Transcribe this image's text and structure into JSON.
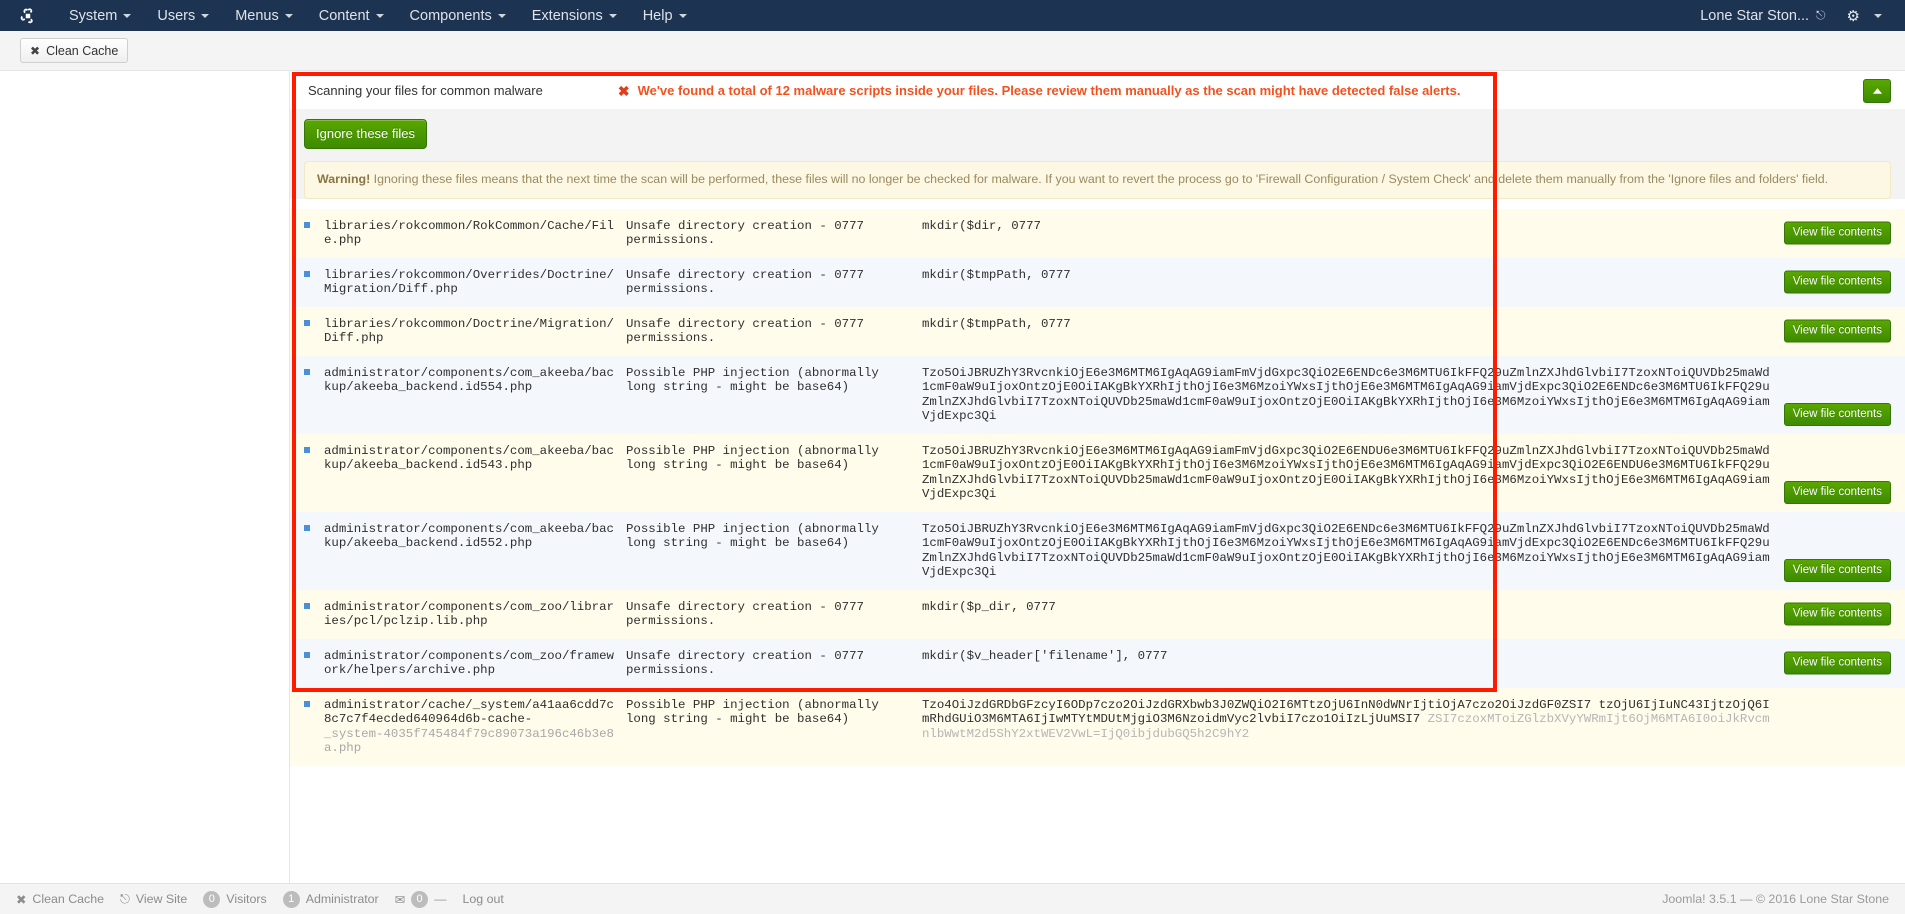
{
  "adminbar": {
    "logo_icon": "joomla-logo-icon",
    "menus": [
      {
        "label": "System"
      },
      {
        "label": "Users"
      },
      {
        "label": "Menus"
      },
      {
        "label": "Content"
      },
      {
        "label": "Components"
      },
      {
        "label": "Extensions"
      },
      {
        "label": "Help"
      }
    ],
    "site_name": "Lone Star Ston...",
    "external_link_icon": "external-link-icon",
    "gear_icon": "gear-icon"
  },
  "toolbar": {
    "clean_cache_label": "Clean Cache",
    "clean_cache_icon": "wrench-icon"
  },
  "panel": {
    "title": "Scanning your files for common malware",
    "alert_icon": "error-x-icon",
    "alert_text": "We've found a total of 12 malware scripts inside your files. Please review them manually as the scan might have detected false alerts.",
    "ignore_button": "Ignore these files",
    "warning_label": "Warning!",
    "warning_text": " Ignoring these files means that the next time the scan will be performed, these files will no longer be checked for malware. If you want to revert the process go to 'Firewall Configuration / System Check' and delete them manually from the 'Ignore files and folders' field.",
    "view_button_label": "View file contents",
    "scroll_top_icon": "chevron-up-icon"
  },
  "colors": {
    "accent_green": "#4a9600",
    "alert_red": "#f4511e",
    "highlight_box": "#ff1a00",
    "adminbar_bg": "#1c3352",
    "row_odd": "#fffceb",
    "row_even": "#f4f8fd"
  },
  "rows": [
    {
      "path": "libraries/rokcommon/RokCommon/Cache/File.php",
      "reason": "Unsafe directory creation - 0777 permissions.",
      "code": "mkdir($dir, 0777",
      "btn_pos": "middle"
    },
    {
      "path": "libraries/rokcommon/Overrides/Doctrine/Migration/Diff.php",
      "reason": "Unsafe directory creation - 0777 permissions.",
      "code": "mkdir($tmpPath, 0777",
      "btn_pos": "middle"
    },
    {
      "path": "libraries/rokcommon/Doctrine/Migration/Diff.php",
      "reason": "Unsafe directory creation - 0777 permissions.",
      "code": "mkdir($tmpPath, 0777",
      "btn_pos": "middle"
    },
    {
      "path": "administrator/components/com_akeeba/backup/akeeba_backend.id554.php",
      "reason": "Possible PHP injection (abnormally long string - might be base64)",
      "code": "Tzo5OiJBRUZhY3RvcnkiOjE6e3M6MTM6IgAqAG9iamFmVjdGxpc3QiO2E6ENDc6e3M6MTU6IkFFQ29uZmlnZXJhdGlvbiI7TzoxNToiQUVDb25maWd1cmF0aW9uIjoxOntzOjE0OiIAKgBkYXRhIjthOjI6e3M6MzoiYWxsIjthOjE6e3M6MTM6IgAqAG9iamVjdExpc3QiO2E6ENDc6e3M6MTU6IkFFQ29uZmlnZXJhdGlvbiI7TzoxNToiQUVDb25maWd1cmF0aW9uIjoxOntzOjE0OiIAKgBkYXRhIjthOjI6e3M6MzoiYWxsIjthOjE6e3M6MTM6IgAqAG9iamVjdExpc3Qi",
      "btn_pos": "bottom"
    },
    {
      "path": "administrator/components/com_akeeba/backup/akeeba_backend.id543.php",
      "reason": "Possible PHP injection (abnormally long string - might be base64)",
      "code": "Tzo5OiJBRUZhY3RvcnkiOjE6e3M6MTM6IgAqAG9iamFmVjdGxpc3QiO2E6ENDU6e3M6MTU6IkFFQ29uZmlnZXJhdGlvbiI7TzoxNToiQUVDb25maWd1cmF0aW9uIjoxOntzOjE0OiIAKgBkYXRhIjthOjI6e3M6MzoiYWxsIjthOjE6e3M6MTM6IgAqAG9iamVjdExpc3QiO2E6ENDU6e3M6MTU6IkFFQ29uZmlnZXJhdGlvbiI7TzoxNToiQUVDb25maWd1cmF0aW9uIjoxOntzOjE0OiIAKgBkYXRhIjthOjI6e3M6MzoiYWxsIjthOjE6e3M6MTM6IgAqAG9iamVjdExpc3Qi",
      "btn_pos": "bottom"
    },
    {
      "path": "administrator/components/com_akeeba/backup/akeeba_backend.id552.php",
      "reason": "Possible PHP injection (abnormally long string - might be base64)",
      "code": "Tzo5OiJBRUZhY3RvcnkiOjE6e3M6MTM6IgAqAG9iamFmVjdGxpc3QiO2E6ENDc6e3M6MTU6IkFFQ29uZmlnZXJhdGlvbiI7TzoxNToiQUVDb25maWd1cmF0aW9uIjoxOntzOjE0OiIAKgBkYXRhIjthOjI6e3M6MzoiYWxsIjthOjE6e3M6MTM6IgAqAG9iamVjdExpc3QiO2E6ENDc6e3M6MTU6IkFFQ29uZmlnZXJhdGlvbiI7TzoxNToiQUVDb25maWd1cmF0aW9uIjoxOntzOjE0OiIAKgBkYXRhIjthOjI6e3M6MzoiYWxsIjthOjE6e3M6MTM6IgAqAG9iamVjdExpc3Qi",
      "btn_pos": "bottom"
    },
    {
      "path": "administrator/components/com_zoo/libraries/pcl/pclzip.lib.php",
      "reason": "Unsafe directory creation - 0777 permissions.",
      "code": "mkdir($p_dir, 0777",
      "btn_pos": "middle"
    },
    {
      "path": "administrator/components/com_zoo/framework/helpers/archive.php",
      "reason": "Unsafe directory creation - 0777 permissions.",
      "code": "mkdir($v_header['filename'], 0777",
      "btn_pos": "middle"
    },
    {
      "path": "administrator/cache/_system/a41aa6cdd7c8c7c7f4ecded640964d6b-cache-",
      "path_muted": "_system-4035f745484f79c89073a196c46b3e8a.php",
      "reason": "Possible PHP injection (abnormally long string - might be base64)",
      "code": "Tzo4OiJzdGRDbGFzcyI6ODp7czo2OiJzdGRXbwb3J0ZWQiO2I6MTtzOjU6InN0dWNrIjtiOjA7czo2OiJzdGF0ZSI7",
      "code2": "tzOjU6IjIuNC43IjtzOjQ6ImRhdGUiO3M6MTA6IjIwMTYtMDUtMjgiO3M6NzoidmVyc2lvbiI7czo1OiIzLjUuMSI7",
      "code3": "ZSI7czoxMToiZGlzbXVyYWRmIjt6OjM6MTA6I0oiJkRvcmnlbWwtM2d5ShY2xtWEV2VwL=IjQ0ibjdubGQ5h2C9hY2",
      "btn_pos": "none"
    }
  ],
  "statusbar": {
    "items": [
      {
        "label": "Clean Cache",
        "icon": "wrench-icon",
        "badge": null
      },
      {
        "label": "View Site",
        "icon": "external-link-icon",
        "badge": null
      },
      {
        "label": "Visitors",
        "icon": null,
        "badge": "0"
      },
      {
        "label": "Administrator",
        "icon": null,
        "badge": "1"
      },
      {
        "label": "",
        "icon": "envelope-icon",
        "badge": "0"
      },
      {
        "label": "Log out",
        "icon": null,
        "badge": null
      }
    ],
    "right_text": "Joomla! 3.5.1  —  © 2016 Lone Star Stone"
  }
}
